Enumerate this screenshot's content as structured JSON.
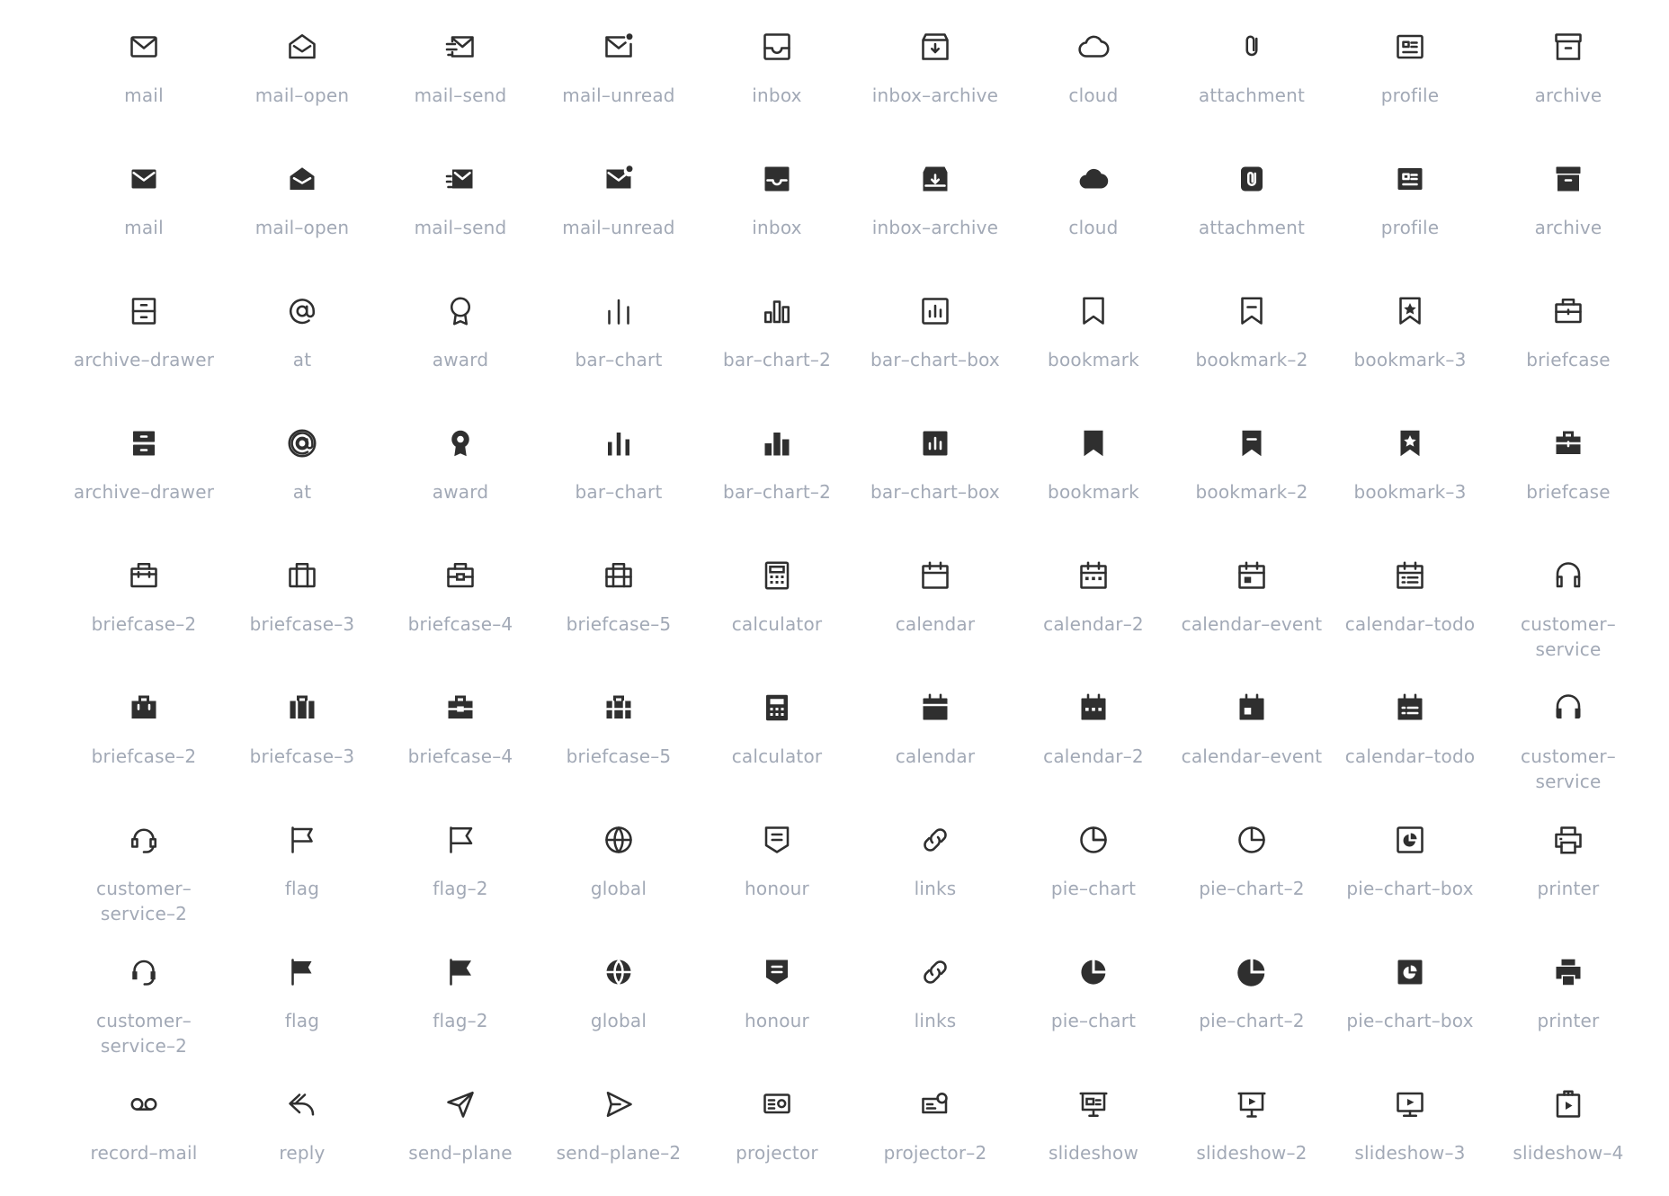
{
  "accent": "#2f2f2f",
  "label_color": "#a2a9b6",
  "icons": [
    {
      "name": "mail",
      "label": "mail",
      "glyph": "mail",
      "style": "line"
    },
    {
      "name": "mail-open",
      "label": "mail–open",
      "glyph": "mail-open",
      "style": "line"
    },
    {
      "name": "mail-send",
      "label": "mail–send",
      "glyph": "mail-send",
      "style": "line"
    },
    {
      "name": "mail-unread",
      "label": "mail–unread",
      "glyph": "mail-unread",
      "style": "line"
    },
    {
      "name": "inbox",
      "label": "inbox",
      "glyph": "inbox",
      "style": "line"
    },
    {
      "name": "inbox-archive",
      "label": "inbox–archive",
      "glyph": "inbox-archive",
      "style": "line"
    },
    {
      "name": "cloud",
      "label": "cloud",
      "glyph": "cloud",
      "style": "line"
    },
    {
      "name": "attachment",
      "label": "attachment",
      "glyph": "attachment",
      "style": "line"
    },
    {
      "name": "profile",
      "label": "profile",
      "glyph": "profile",
      "style": "line"
    },
    {
      "name": "archive",
      "label": "archive",
      "glyph": "archive",
      "style": "line"
    },
    {
      "name": "mail",
      "label": "mail",
      "glyph": "mail",
      "style": "fill"
    },
    {
      "name": "mail-open",
      "label": "mail–open",
      "glyph": "mail-open",
      "style": "fill"
    },
    {
      "name": "mail-send",
      "label": "mail–send",
      "glyph": "mail-send",
      "style": "fill"
    },
    {
      "name": "mail-unread",
      "label": "mail–unread",
      "glyph": "mail-unread",
      "style": "fill"
    },
    {
      "name": "inbox",
      "label": "inbox",
      "glyph": "inbox",
      "style": "fill"
    },
    {
      "name": "inbox-archive",
      "label": "inbox–archive",
      "glyph": "inbox-archive",
      "style": "fill"
    },
    {
      "name": "cloud",
      "label": "cloud",
      "glyph": "cloud",
      "style": "fill"
    },
    {
      "name": "attachment",
      "label": "attachment",
      "glyph": "attachment",
      "style": "fill"
    },
    {
      "name": "profile",
      "label": "profile",
      "glyph": "profile",
      "style": "fill"
    },
    {
      "name": "archive",
      "label": "archive",
      "glyph": "archive",
      "style": "fill"
    },
    {
      "name": "archive-drawer",
      "label": "archive–drawer",
      "glyph": "archive-drawer",
      "style": "line"
    },
    {
      "name": "at",
      "label": "at",
      "glyph": "at",
      "style": "line"
    },
    {
      "name": "award",
      "label": "award",
      "glyph": "award",
      "style": "line"
    },
    {
      "name": "bar-chart",
      "label": "bar–chart",
      "glyph": "bar-chart",
      "style": "line"
    },
    {
      "name": "bar-chart-2",
      "label": "bar–chart–2",
      "glyph": "bar-chart-2",
      "style": "line"
    },
    {
      "name": "bar-chart-box",
      "label": "bar–chart–box",
      "glyph": "bar-chart-box",
      "style": "line"
    },
    {
      "name": "bookmark",
      "label": "bookmark",
      "glyph": "bookmark",
      "style": "line"
    },
    {
      "name": "bookmark-2",
      "label": "bookmark–2",
      "glyph": "bookmark-2",
      "style": "line"
    },
    {
      "name": "bookmark-3",
      "label": "bookmark–3",
      "glyph": "bookmark-3",
      "style": "line"
    },
    {
      "name": "briefcase",
      "label": "briefcase",
      "glyph": "briefcase",
      "style": "line"
    },
    {
      "name": "archive-drawer",
      "label": "archive–drawer",
      "glyph": "archive-drawer",
      "style": "fill"
    },
    {
      "name": "at",
      "label": "at",
      "glyph": "at",
      "style": "fill"
    },
    {
      "name": "award",
      "label": "award",
      "glyph": "award",
      "style": "fill"
    },
    {
      "name": "bar-chart",
      "label": "bar–chart",
      "glyph": "bar-chart",
      "style": "fill"
    },
    {
      "name": "bar-chart-2",
      "label": "bar–chart–2",
      "glyph": "bar-chart-2",
      "style": "fill"
    },
    {
      "name": "bar-chart-box",
      "label": "bar–chart–box",
      "glyph": "bar-chart-box",
      "style": "fill"
    },
    {
      "name": "bookmark",
      "label": "bookmark",
      "glyph": "bookmark",
      "style": "fill"
    },
    {
      "name": "bookmark-2",
      "label": "bookmark–2",
      "glyph": "bookmark-2",
      "style": "fill"
    },
    {
      "name": "bookmark-3",
      "label": "bookmark–3",
      "glyph": "bookmark-3",
      "style": "fill"
    },
    {
      "name": "briefcase",
      "label": "briefcase",
      "glyph": "briefcase",
      "style": "fill"
    },
    {
      "name": "briefcase-2",
      "label": "briefcase–2",
      "glyph": "briefcase-2",
      "style": "line"
    },
    {
      "name": "briefcase-3",
      "label": "briefcase–3",
      "glyph": "briefcase-3",
      "style": "line"
    },
    {
      "name": "briefcase-4",
      "label": "briefcase–4",
      "glyph": "briefcase-4",
      "style": "line"
    },
    {
      "name": "briefcase-5",
      "label": "briefcase–5",
      "glyph": "briefcase-5",
      "style": "line"
    },
    {
      "name": "calculator",
      "label": "calculator",
      "glyph": "calculator",
      "style": "line"
    },
    {
      "name": "calendar",
      "label": "calendar",
      "glyph": "calendar",
      "style": "line"
    },
    {
      "name": "calendar-2",
      "label": "calendar–2",
      "glyph": "calendar-2",
      "style": "line"
    },
    {
      "name": "calendar-event",
      "label": "calendar–event",
      "glyph": "calendar-event",
      "style": "line"
    },
    {
      "name": "calendar-todo",
      "label": "calendar–todo",
      "glyph": "calendar-todo",
      "style": "line"
    },
    {
      "name": "customer-service",
      "label": "customer–service",
      "glyph": "customer-service",
      "style": "line"
    },
    {
      "name": "briefcase-2",
      "label": "briefcase–2",
      "glyph": "briefcase-2",
      "style": "fill"
    },
    {
      "name": "briefcase-3",
      "label": "briefcase–3",
      "glyph": "briefcase-3",
      "style": "fill"
    },
    {
      "name": "briefcase-4",
      "label": "briefcase–4",
      "glyph": "briefcase-4",
      "style": "fill"
    },
    {
      "name": "briefcase-5",
      "label": "briefcase–5",
      "glyph": "briefcase-5",
      "style": "fill"
    },
    {
      "name": "calculator",
      "label": "calculator",
      "glyph": "calculator",
      "style": "fill"
    },
    {
      "name": "calendar",
      "label": "calendar",
      "glyph": "calendar",
      "style": "fill"
    },
    {
      "name": "calendar-2",
      "label": "calendar–2",
      "glyph": "calendar-2",
      "style": "fill"
    },
    {
      "name": "calendar-event",
      "label": "calendar–event",
      "glyph": "calendar-event",
      "style": "fill"
    },
    {
      "name": "calendar-todo",
      "label": "calendar–todo",
      "glyph": "calendar-todo",
      "style": "fill"
    },
    {
      "name": "customer-service",
      "label": "customer–service",
      "glyph": "customer-service",
      "style": "fill"
    },
    {
      "name": "customer-service-2",
      "label": "customer–\nservice–2",
      "glyph": "customer-service-2",
      "style": "line"
    },
    {
      "name": "flag",
      "label": "flag",
      "glyph": "flag",
      "style": "line"
    },
    {
      "name": "flag-2",
      "label": "flag–2",
      "glyph": "flag-2",
      "style": "line"
    },
    {
      "name": "global",
      "label": "global",
      "glyph": "global",
      "style": "line"
    },
    {
      "name": "honour",
      "label": "honour",
      "glyph": "honour",
      "style": "line"
    },
    {
      "name": "links",
      "label": "links",
      "glyph": "links",
      "style": "line"
    },
    {
      "name": "pie-chart",
      "label": "pie–chart",
      "glyph": "pie-chart",
      "style": "line"
    },
    {
      "name": "pie-chart-2",
      "label": "pie–chart–2",
      "glyph": "pie-chart-2",
      "style": "line"
    },
    {
      "name": "pie-chart-box",
      "label": "pie–chart–box",
      "glyph": "pie-chart-box",
      "style": "line"
    },
    {
      "name": "printer",
      "label": "printer",
      "glyph": "printer",
      "style": "line"
    },
    {
      "name": "customer-service-2",
      "label": "customer–\nservice–2",
      "glyph": "customer-service-2",
      "style": "fill"
    },
    {
      "name": "flag",
      "label": "flag",
      "glyph": "flag",
      "style": "fill"
    },
    {
      "name": "flag-2",
      "label": "flag–2",
      "glyph": "flag-2",
      "style": "fill"
    },
    {
      "name": "global",
      "label": "global",
      "glyph": "global",
      "style": "fill"
    },
    {
      "name": "honour",
      "label": "honour",
      "glyph": "honour",
      "style": "fill"
    },
    {
      "name": "links",
      "label": "links",
      "glyph": "links",
      "style": "fill"
    },
    {
      "name": "pie-chart",
      "label": "pie–chart",
      "glyph": "pie-chart",
      "style": "fill"
    },
    {
      "name": "pie-chart-2",
      "label": "pie–chart–2",
      "glyph": "pie-chart-2",
      "style": "fill"
    },
    {
      "name": "pie-chart-box",
      "label": "pie–chart–box",
      "glyph": "pie-chart-box",
      "style": "fill"
    },
    {
      "name": "printer",
      "label": "printer",
      "glyph": "printer",
      "style": "fill"
    },
    {
      "name": "record-mail",
      "label": "record–mail",
      "glyph": "record-mail",
      "style": "line"
    },
    {
      "name": "reply",
      "label": "reply",
      "glyph": "reply",
      "style": "line"
    },
    {
      "name": "send-plane",
      "label": "send–plane",
      "glyph": "send-plane",
      "style": "line"
    },
    {
      "name": "send-plane-2",
      "label": "send–plane–2",
      "glyph": "send-plane-2",
      "style": "line"
    },
    {
      "name": "projector",
      "label": "projector",
      "glyph": "projector",
      "style": "line"
    },
    {
      "name": "projector-2",
      "label": "projector–2",
      "glyph": "projector-2",
      "style": "line"
    },
    {
      "name": "slideshow",
      "label": "slideshow",
      "glyph": "slideshow",
      "style": "line"
    },
    {
      "name": "slideshow-2",
      "label": "slideshow–2",
      "glyph": "slideshow-2",
      "style": "line"
    },
    {
      "name": "slideshow-3",
      "label": "slideshow–3",
      "glyph": "slideshow-3",
      "style": "line"
    },
    {
      "name": "slideshow-4",
      "label": "slideshow–4",
      "glyph": "slideshow-4",
      "style": "line"
    }
  ]
}
